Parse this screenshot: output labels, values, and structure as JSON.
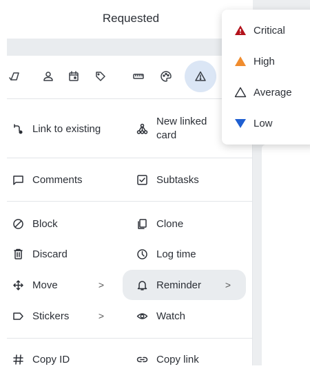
{
  "header": {
    "title": "Requested"
  },
  "toolbar": {
    "icons": [
      "resize-icon",
      "user-icon",
      "calendar-icon",
      "tag-icon",
      "ruler-icon",
      "palette-icon",
      "priority-warning-icon"
    ]
  },
  "menu": {
    "link_to_existing": "Link to existing",
    "new_linked_card": "New linked card",
    "comments": "Comments",
    "subtasks": "Subtasks",
    "block": "Block",
    "clone": "Clone",
    "discard": "Discard",
    "log_time": "Log time",
    "move": "Move",
    "reminder": "Reminder",
    "stickers": "Stickers",
    "watch": "Watch",
    "copy_id": "Copy ID",
    "copy_link": "Copy link",
    "submenu_chevron": ">"
  },
  "priority_dropdown": {
    "items": [
      {
        "label": "Critical",
        "color": "#b3121b",
        "icon": "triangle-filled-icon"
      },
      {
        "label": "High",
        "color": "#f08c2e",
        "icon": "triangle-filled-icon"
      },
      {
        "label": "Average",
        "color": "#2b2f36",
        "icon": "triangle-outline-icon"
      },
      {
        "label": "Low",
        "color": "#1f5fd1",
        "icon": "triangle-down-icon"
      }
    ]
  }
}
